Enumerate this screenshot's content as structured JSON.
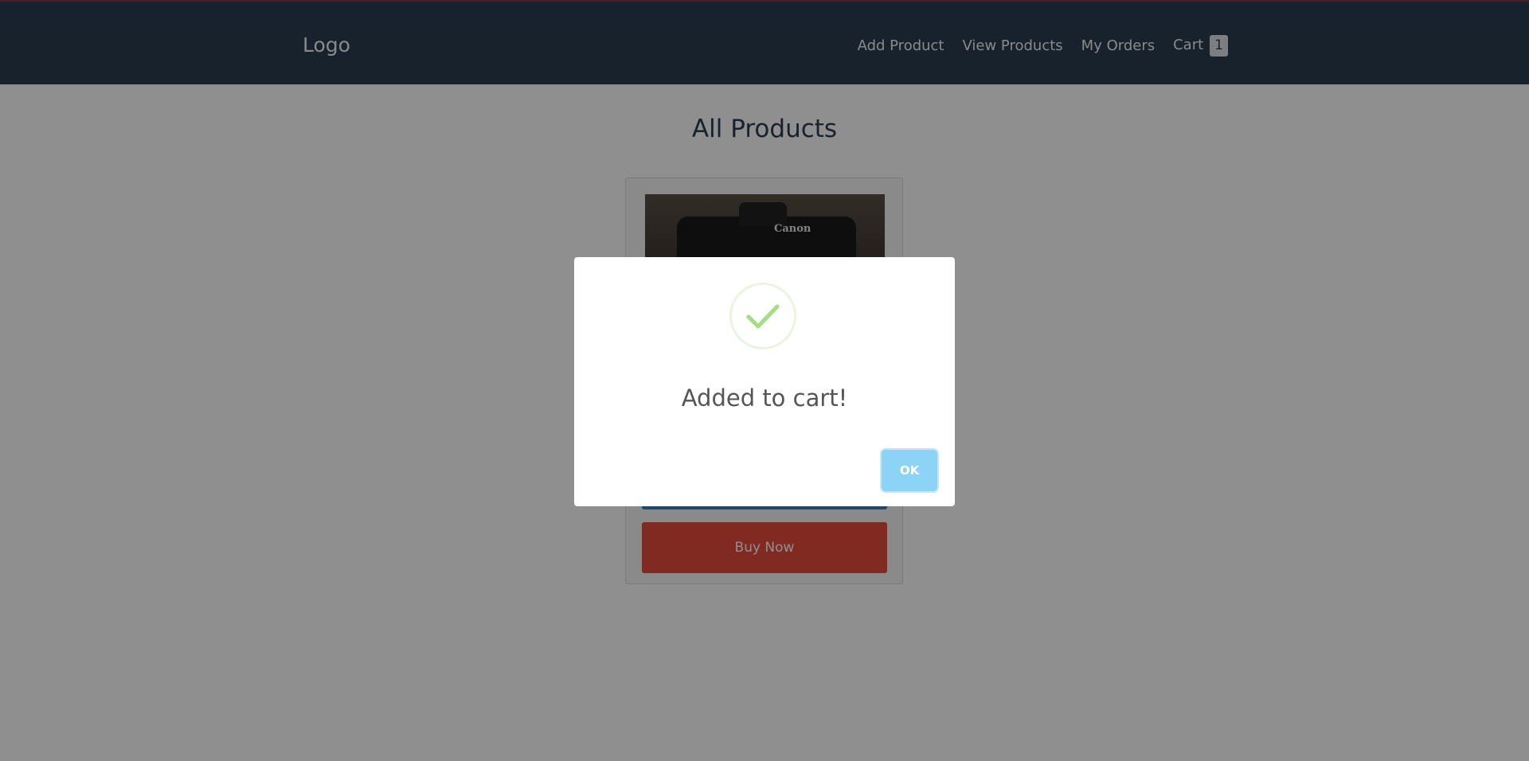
{
  "nav": {
    "logo": "Logo",
    "links": [
      "Add Product",
      "View Products",
      "My Orders"
    ],
    "cart_label": "Cart",
    "cart_count": "1"
  },
  "main": {
    "title": "All Products",
    "product": {
      "brand_text": "Canon",
      "buy_now_label": "Buy Now"
    }
  },
  "modal": {
    "title": "Added to cart!",
    "ok_label": "OK",
    "icon": "check-icon"
  },
  "colors": {
    "navbar": "#2c3e50",
    "buy_now": "#e74c3c",
    "add_to_cart": "#2f80c9",
    "ok_button": "#8cd4f5",
    "success": "#a5dc86"
  }
}
